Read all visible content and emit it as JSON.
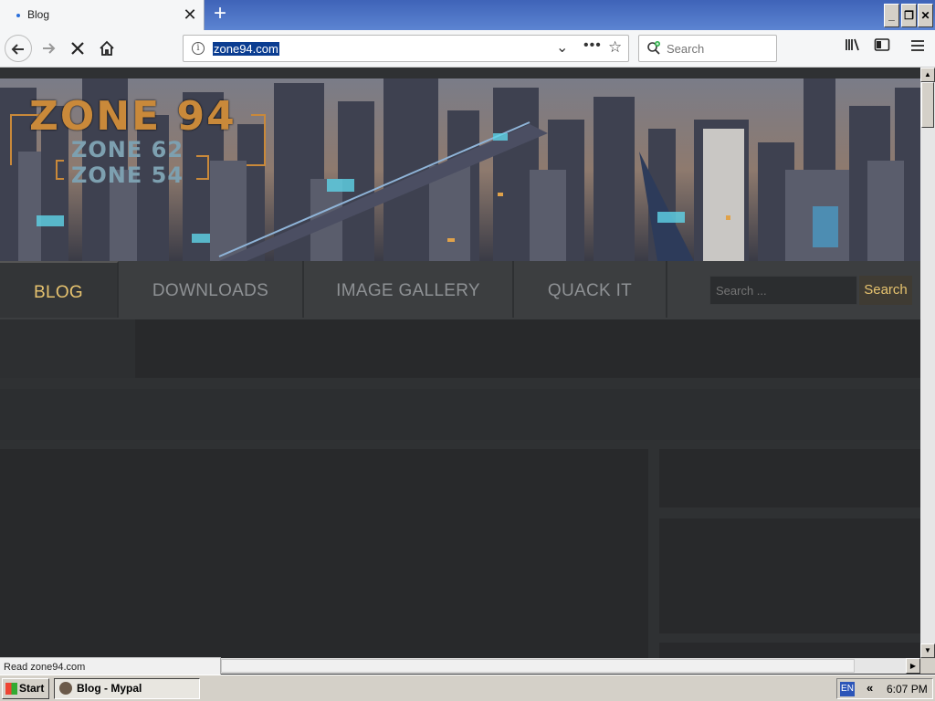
{
  "browser": {
    "tab_title": "Blog",
    "tab_close": "✕",
    "new_tab": "+",
    "url": "zone94.com",
    "search_placeholder": "Search",
    "status_text": "Read zone94.com",
    "window_controls": {
      "minimize": "_",
      "restore": "❐",
      "close": "✕"
    },
    "icons": [
      "back-arrow-icon",
      "forward-arrow-icon",
      "stop-icon",
      "home-icon",
      "info-icon",
      "dropdown-icon",
      "more-icon",
      "star-icon",
      "library-icon",
      "sidebar-icon",
      "menu-icon"
    ]
  },
  "site": {
    "logo": {
      "line1": "ZONE 94",
      "line2": "ZONE 62",
      "line3": "ZONE 54"
    },
    "menu": [
      {
        "label": "BLOG"
      },
      {
        "label": "DOWNLOADS"
      },
      {
        "label": "IMAGE GALLERY"
      },
      {
        "label": "QUACK IT"
      }
    ],
    "search_placeholder": "Search ...",
    "search_button": "Search"
  },
  "taskbar": {
    "start": "Start",
    "item": "Blog - Mypal",
    "lang": "EN",
    "chevron": "«",
    "time": "6:07 PM"
  },
  "colors": {
    "accent": "#e7c36f",
    "page_bg": "#2f3133",
    "menu_bg": "#3c3e40"
  }
}
